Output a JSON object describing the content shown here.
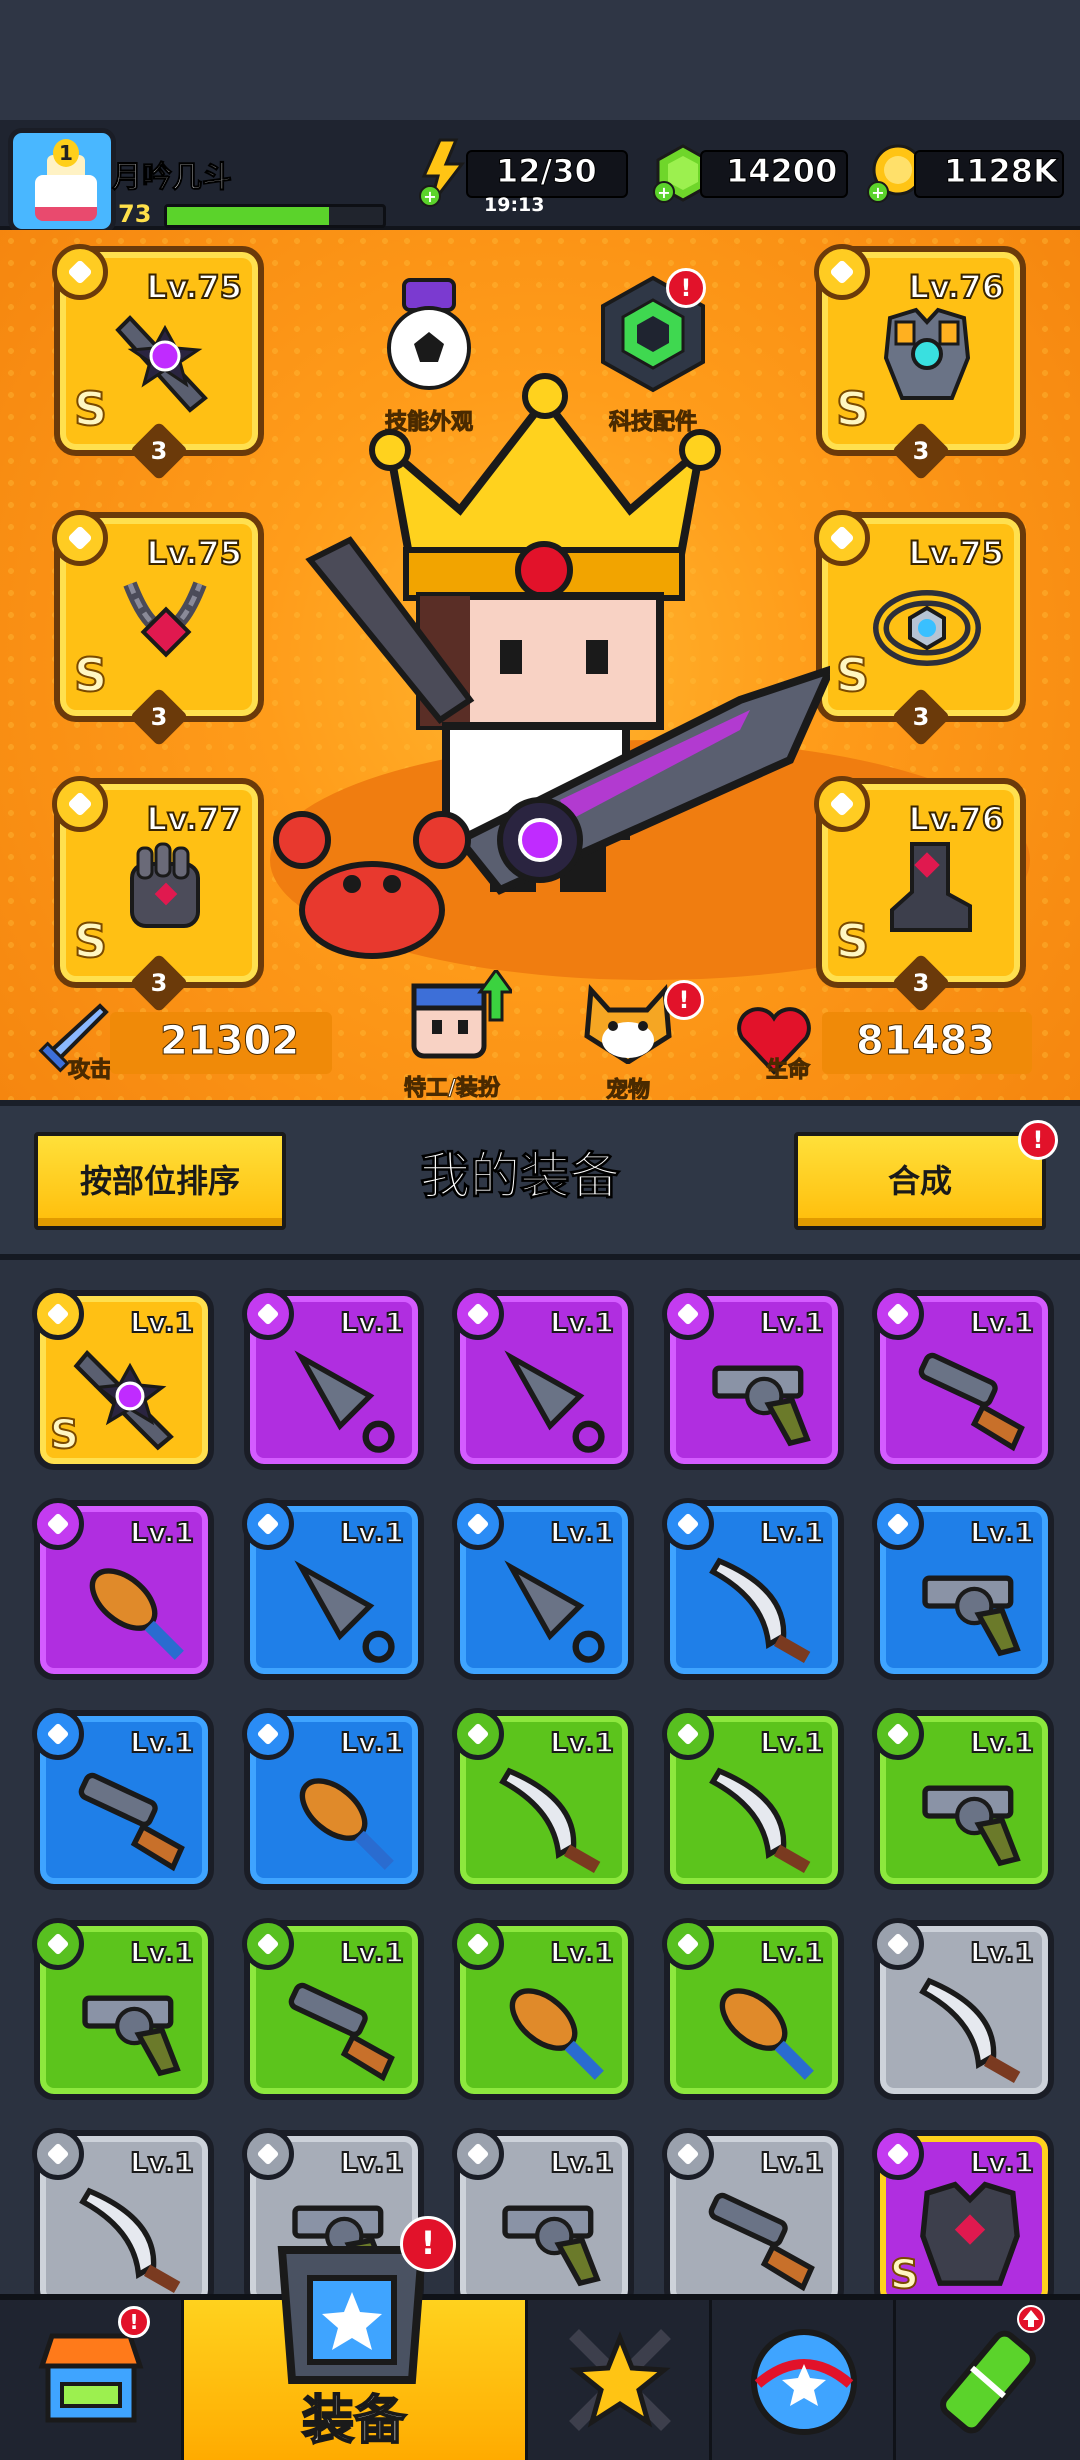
{
  "player": {
    "name": "月吟几斗",
    "level": "73",
    "avatar_rank": "1",
    "xp_fraction": 0.75
  },
  "resources": {
    "energy": "12/30",
    "energy_timer": "19:13",
    "gems": "14200",
    "coins": "1128K"
  },
  "features": {
    "skill_skin": "技能外观",
    "tech_parts": "科技配件",
    "agent_outfit": "特工/装扮",
    "pet": "宠物",
    "tech_alert": "!",
    "pet_alert": "!"
  },
  "equipped": {
    "weapon": {
      "level": "Lv.75",
      "rank": "S",
      "stars": "3"
    },
    "necklace": {
      "level": "Lv.75",
      "rank": "S",
      "stars": "3"
    },
    "gloves": {
      "level": "Lv.77",
      "rank": "S",
      "stars": "3"
    },
    "armor": {
      "level": "Lv.76",
      "rank": "S",
      "stars": "3"
    },
    "belt": {
      "level": "Lv.75",
      "rank": "S",
      "stars": "3"
    },
    "boots": {
      "level": "Lv.76",
      "rank": "S",
      "stars": "3"
    }
  },
  "stats": {
    "attack_label": "攻击",
    "attack_value": "21302",
    "hp_label": "生命",
    "hp_value": "81483"
  },
  "equipment_section": {
    "sort_button": "按部位排序",
    "title": "我的装备",
    "merge_button": "合成",
    "merge_alert": "!"
  },
  "inventory": [
    {
      "quality": "legend",
      "level": "Lv.1",
      "rank": "S",
      "icon": "shuriken-blade-icon"
    },
    {
      "quality": "epic",
      "level": "Lv.1",
      "rank": "",
      "icon": "kunai-icon"
    },
    {
      "quality": "epic",
      "level": "Lv.1",
      "rank": "",
      "icon": "kunai-icon"
    },
    {
      "quality": "epic",
      "level": "Lv.1",
      "rank": "",
      "icon": "revolver-icon"
    },
    {
      "quality": "epic",
      "level": "Lv.1",
      "rank": "",
      "icon": "shotgun-icon"
    },
    {
      "quality": "epic",
      "level": "Lv.1",
      "rank": "",
      "icon": "bat-icon"
    },
    {
      "quality": "rare",
      "level": "Lv.1",
      "rank": "",
      "icon": "kunai-icon"
    },
    {
      "quality": "rare",
      "level": "Lv.1",
      "rank": "",
      "icon": "kunai-icon"
    },
    {
      "quality": "rare",
      "level": "Lv.1",
      "rank": "",
      "icon": "machete-icon"
    },
    {
      "quality": "rare",
      "level": "Lv.1",
      "rank": "",
      "icon": "revolver-icon"
    },
    {
      "quality": "rare",
      "level": "Lv.1",
      "rank": "",
      "icon": "shotgun-icon"
    },
    {
      "quality": "rare",
      "level": "Lv.1",
      "rank": "",
      "icon": "bat-icon"
    },
    {
      "quality": "good",
      "level": "Lv.1",
      "rank": "",
      "icon": "machete-icon"
    },
    {
      "quality": "good",
      "level": "Lv.1",
      "rank": "",
      "icon": "machete-icon"
    },
    {
      "quality": "good",
      "level": "Lv.1",
      "rank": "",
      "icon": "revolver-icon"
    },
    {
      "quality": "good",
      "level": "Lv.1",
      "rank": "",
      "icon": "revolver-icon"
    },
    {
      "quality": "good",
      "level": "Lv.1",
      "rank": "",
      "icon": "shotgun-icon"
    },
    {
      "quality": "good",
      "level": "Lv.1",
      "rank": "",
      "icon": "bat-icon"
    },
    {
      "quality": "good",
      "level": "Lv.1",
      "rank": "",
      "icon": "bat-icon"
    },
    {
      "quality": "common",
      "level": "Lv.1",
      "rank": "",
      "icon": "machete-icon"
    },
    {
      "quality": "common",
      "level": "Lv.1",
      "rank": "",
      "icon": "machete-icon"
    },
    {
      "quality": "common",
      "level": "Lv.1",
      "rank": "",
      "icon": "revolver-icon"
    },
    {
      "quality": "common",
      "level": "Lv.1",
      "rank": "",
      "icon": "revolver-icon"
    },
    {
      "quality": "common",
      "level": "Lv.1",
      "rank": "",
      "icon": "shotgun-icon"
    },
    {
      "quality": "epic-legend",
      "level": "Lv.1",
      "rank": "S",
      "icon": "armor-icon"
    }
  ],
  "nav": {
    "equip_label": "装备",
    "equip_alert": "!",
    "shop_alert": "!"
  },
  "colors": {
    "legend": "#ffc014",
    "epic": "#b02ee0",
    "rare": "#1f7fe8",
    "good": "#5cc41c",
    "common": "#a7adb8",
    "panel_orange": "#ff9c1a"
  }
}
